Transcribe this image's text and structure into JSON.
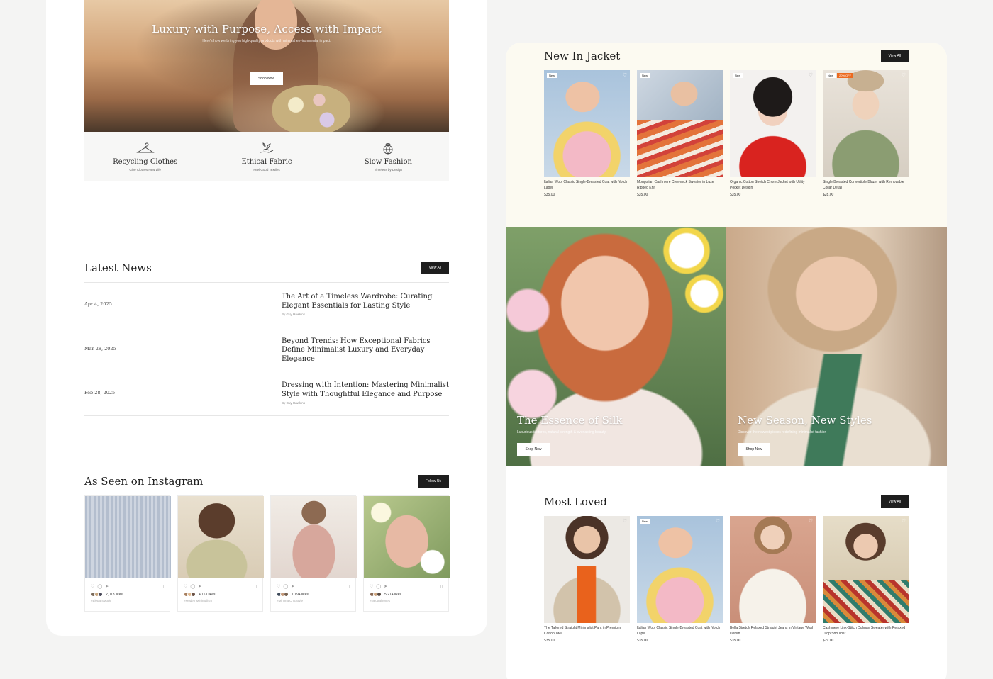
{
  "hero": {
    "title": "Luxury with Purpose, Access with Impact",
    "subtitle": "Here's how we bring you high-quality products with minimal environmental impact.",
    "button": "Shop Now"
  },
  "features": [
    {
      "title": "Recycling Clothes",
      "subtitle": "Give Clothes New Life",
      "icon": "hanger-icon"
    },
    {
      "title": "Ethical Fabric",
      "subtitle": "Feel Good Textiles",
      "icon": "hand-leaf-icon"
    },
    {
      "title": "Slow Fashion",
      "subtitle": "Timeless by Design",
      "icon": "globe-leaf-icon"
    }
  ],
  "news": {
    "title": "Latest News",
    "button": "View All",
    "items": [
      {
        "date": "Apr 4, 2025",
        "title": "The Art of a Timeless Wardrobe: Curating Elegant Essentials for Lasting Style",
        "author": "By Guy Hawkins"
      },
      {
        "date": "Mar 28, 2025",
        "title": "Beyond Trends: How Exceptional Fabrics Define Minimalist Luxury and Everyday Elegance",
        "author": "By Guy Hawkins"
      },
      {
        "date": "Feb 28, 2025",
        "title": "Dressing with Intention: Mastering Minimalist Style with Thoughtful Elegance and Purpose",
        "author": "By Guy Hawkins"
      }
    ]
  },
  "instagram": {
    "title": "As Seen on Instagram",
    "button": "Follow Us",
    "posts": [
      {
        "likes": "2,018 likes",
        "tag": "#ElegantMode"
      },
      {
        "likes": "4,113 likes",
        "tag": "#ModernMinimalism"
      },
      {
        "likes": "1,194 likes",
        "tag": "#MinimalChicStyle"
      },
      {
        "likes": "5,214 likes",
        "tag": "#NeutralTones"
      }
    ]
  },
  "new_in": {
    "title": "New In Jacket",
    "button": "View All",
    "products": [
      {
        "name": "Italian Wool Classic Single-Breasted Coat with Notch Lapel",
        "price": "$35.00",
        "badge": "New",
        "sale": ""
      },
      {
        "name": "Mongolian Cashmere Crewneck Sweater in Luxe Ribbed Knit",
        "price": "$35.00",
        "badge": "New",
        "sale": ""
      },
      {
        "name": "Organic Cotton Stretch Chore Jacket with Utility Pocket Design",
        "price": "$35.00",
        "badge": "New",
        "sale": ""
      },
      {
        "name": "Single Breasted Convertible Blazer with Removable Collar Detail",
        "price": "$28.00",
        "badge": "New",
        "sale": "20% OFF"
      }
    ]
  },
  "promos": [
    {
      "title": "The Essence of Silk",
      "subtitle": "Luxurious textures, natural strength & everlasting beauty",
      "button": "Shop Now"
    },
    {
      "title": "New Season, New Styles",
      "subtitle": "Discover the newest pieces redefining minimalist fashion",
      "button": "Shop Now"
    }
  ],
  "most_loved": {
    "title": "Most Loved",
    "button": "View All",
    "products": [
      {
        "name": "The Tailored Straight Minimalist Pant in Premium Cotton Twill",
        "price": "$35.00",
        "badge": ""
      },
      {
        "name": "Italian Wool Classic Single-Breasted Coat with Notch Lapel",
        "price": "$35.00",
        "badge": "New"
      },
      {
        "name": "Bella Stretch Relaxed Straight Jeans in Vintage Wash Denim",
        "price": "$35.00",
        "badge": ""
      },
      {
        "name": "Cashmere Link-Stitch Dolman Sweater with Relaxed Drop Shoulder",
        "price": "$29.00",
        "badge": ""
      }
    ]
  },
  "colors": {
    "dark_button": "#1e1e1e",
    "sale_badge": "#ec6a1f",
    "cream_bg": "#fcfaf1"
  }
}
